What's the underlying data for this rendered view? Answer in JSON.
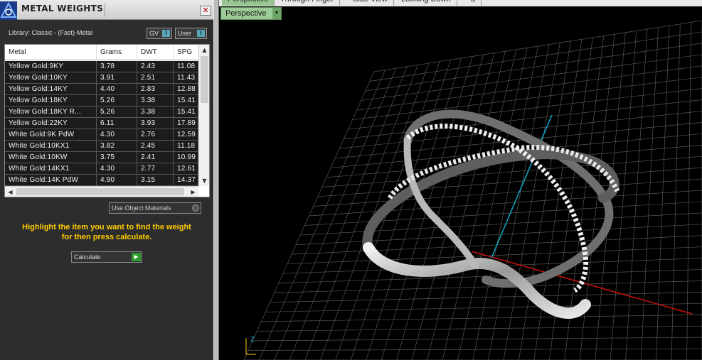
{
  "panel": {
    "title": "METAL WEIGHTS",
    "close_glyph": "✕",
    "library_label": "Library: Classic - (Fast)-Metal",
    "gv_label": "GV",
    "user_label": "User",
    "toggle_indicator": "I",
    "columns": [
      "Metal",
      "Grams",
      "DWT",
      "SPG"
    ],
    "rows": [
      {
        "metal": "Yellow Gold:9KY",
        "grams": "3.78",
        "dwt": "2.43",
        "spg": "11.08"
      },
      {
        "metal": "Yellow Gold:10KY",
        "grams": "3.91",
        "dwt": "2.51",
        "spg": "11.43"
      },
      {
        "metal": "Yellow Gold:14KY",
        "grams": "4.40",
        "dwt": "2.83",
        "spg": "12.88"
      },
      {
        "metal": "Yellow Gold:18KY",
        "grams": "5.26",
        "dwt": "3.38",
        "spg": "15.41"
      },
      {
        "metal": "Yellow Gold:18KY R...",
        "grams": "5.26",
        "dwt": "3.38",
        "spg": "15.41"
      },
      {
        "metal": "Yellow Gold:22KY",
        "grams": "6.11",
        "dwt": "3.93",
        "spg": "17.89"
      },
      {
        "metal": "White Gold:9K PdW",
        "grams": "4.30",
        "dwt": "2.76",
        "spg": "12.59"
      },
      {
        "metal": "White Gold:10KX1",
        "grams": "3.82",
        "dwt": "2.45",
        "spg": "11.18"
      },
      {
        "metal": "White Gold:10KW",
        "grams": "3.75",
        "dwt": "2.41",
        "spg": "10.99"
      },
      {
        "metal": "White Gold:14KX1",
        "grams": "4.30",
        "dwt": "2.77",
        "spg": "12.61"
      },
      {
        "metal": "White Gold:14K PdW",
        "grams": "4.90",
        "dwt": "3.15",
        "spg": "14.37"
      }
    ],
    "scroll_up": "▲",
    "scroll_down": "▼",
    "scroll_left": "◀",
    "scroll_right": "▶",
    "use_object_materials": "Use Object Materials",
    "instructions_line1": "Highlight the item you want to find the weight",
    "instructions_line2": "for then press calculate.",
    "calculate_label": "Calculate",
    "calculate_arrow": "▶"
  },
  "viewport": {
    "tabs": [
      "Perspective",
      "Through Finger",
      "Side View",
      "Looking Down",
      "a"
    ],
    "view_dropdown": "Perspective",
    "dropdown_arrow": "▼",
    "axis_z": "Z",
    "colors": {
      "active_tab": "#98c693",
      "grid": "#555555",
      "x_axis": "#cc1111",
      "z_axis": "#11aacc",
      "highlight": "#ffcc00"
    }
  }
}
